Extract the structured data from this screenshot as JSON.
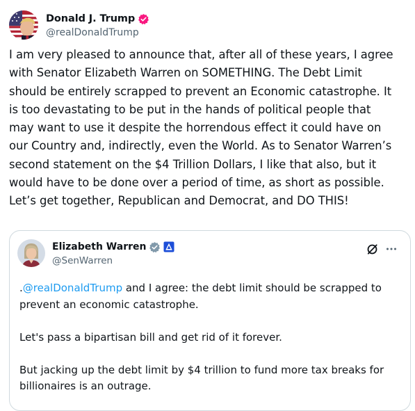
{
  "post": {
    "author": {
      "display_name": "Donald J. Trump",
      "handle": "@realDonaldTrump",
      "badge": "verified-badge-pink",
      "badge_color": "#f91880"
    },
    "text": "I am very pleased to announce that, after all of these years, I agree\nwith Senator Elizabeth Warren on SOMETHING. The Debt Limit\nshould be entirely scrapped to prevent an Economic catastrophe. It\nis too devastating to be put in the hands of political people that\nmay want to use it despite the horrendous effect it could have on\nour Country and, indirectly, even the World. As to Senator Warren’s\nsecond statement on the $4 Trillion Dollars, I like that also, but it\nwould have to be done over a period of time, as short as possible.\nLet’s get together, Republican and Democrat, and DO THIS!"
  },
  "quote": {
    "author": {
      "display_name": "Elizabeth Warren",
      "handle": "@SenWarren",
      "badge": "government-badge-gray",
      "badge_color": "#829aab",
      "affiliate_icon": "senate-affiliate-icon",
      "affiliate_color": "#1d4ed8"
    },
    "body": {
      "prefix": ".",
      "mention": "@realDonaldTrump",
      "line1_rest": " and I agree: the debt limit should be scrapped to prevent an economic catastrophe.",
      "para2": "Let's pass a bipartisan bill and get rid of it forever.",
      "para3": "But jacking up the debt limit by $4 trillion to fund more tax breaks for billionaires is an outrage."
    },
    "actions": {
      "grok_icon": "grok-icon",
      "more_icon": "more-icon"
    }
  },
  "colors": {
    "text": "#0f1419",
    "secondary": "#536471",
    "link": "#1d9bf0",
    "border": "#cfd9de"
  }
}
